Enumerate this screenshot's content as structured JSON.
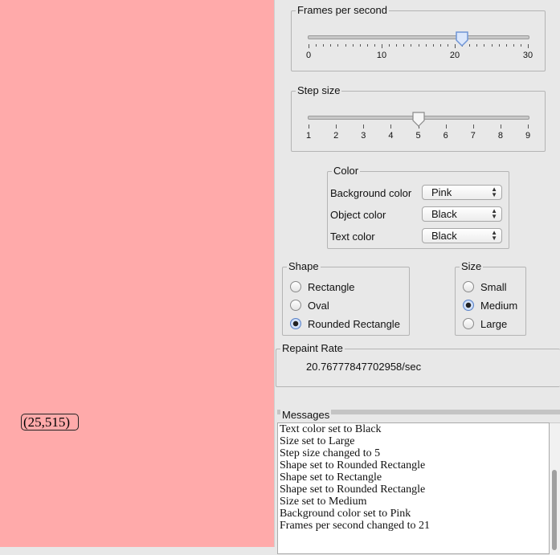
{
  "canvas": {
    "background_color_hex": "#ffaaaa",
    "coordinate_label": "(25,515)"
  },
  "fps": {
    "title": "Frames per second",
    "min": 0,
    "max": 30,
    "value": 21,
    "major_labels": [
      "0",
      "10",
      "20",
      "30"
    ]
  },
  "step": {
    "title": "Step size",
    "min": 1,
    "max": 9,
    "value": 5,
    "major_labels": [
      "1",
      "2",
      "3",
      "4",
      "5",
      "6",
      "7",
      "8",
      "9"
    ]
  },
  "color": {
    "title": "Color",
    "background_label": "Background color",
    "background_value": "Pink",
    "object_label": "Object color",
    "object_value": "Black",
    "text_label": "Text color",
    "text_value": "Black"
  },
  "shape": {
    "title": "Shape",
    "options": [
      "Rectangle",
      "Oval",
      "Rounded Rectangle"
    ],
    "selected": "Rounded Rectangle"
  },
  "size": {
    "title": "Size",
    "options": [
      "Small",
      "Medium",
      "Large"
    ],
    "selected": "Medium"
  },
  "repaint": {
    "title": "Repaint Rate",
    "value": "20.76777847702958/sec"
  },
  "messages": {
    "title": "Messages",
    "items": [
      "Text color set to Black",
      "Size set to Large",
      "Step size changed to 5",
      "Shape set to Rounded Rectangle",
      "Shape set to Rectangle",
      "Shape set to Rounded Rectangle",
      "Size set to Medium",
      "Background color set to Pink",
      "Frames per second changed to 21"
    ]
  },
  "colors": {
    "selection_blue": "#5a82c8",
    "panel_gray": "#e8e8e8"
  }
}
